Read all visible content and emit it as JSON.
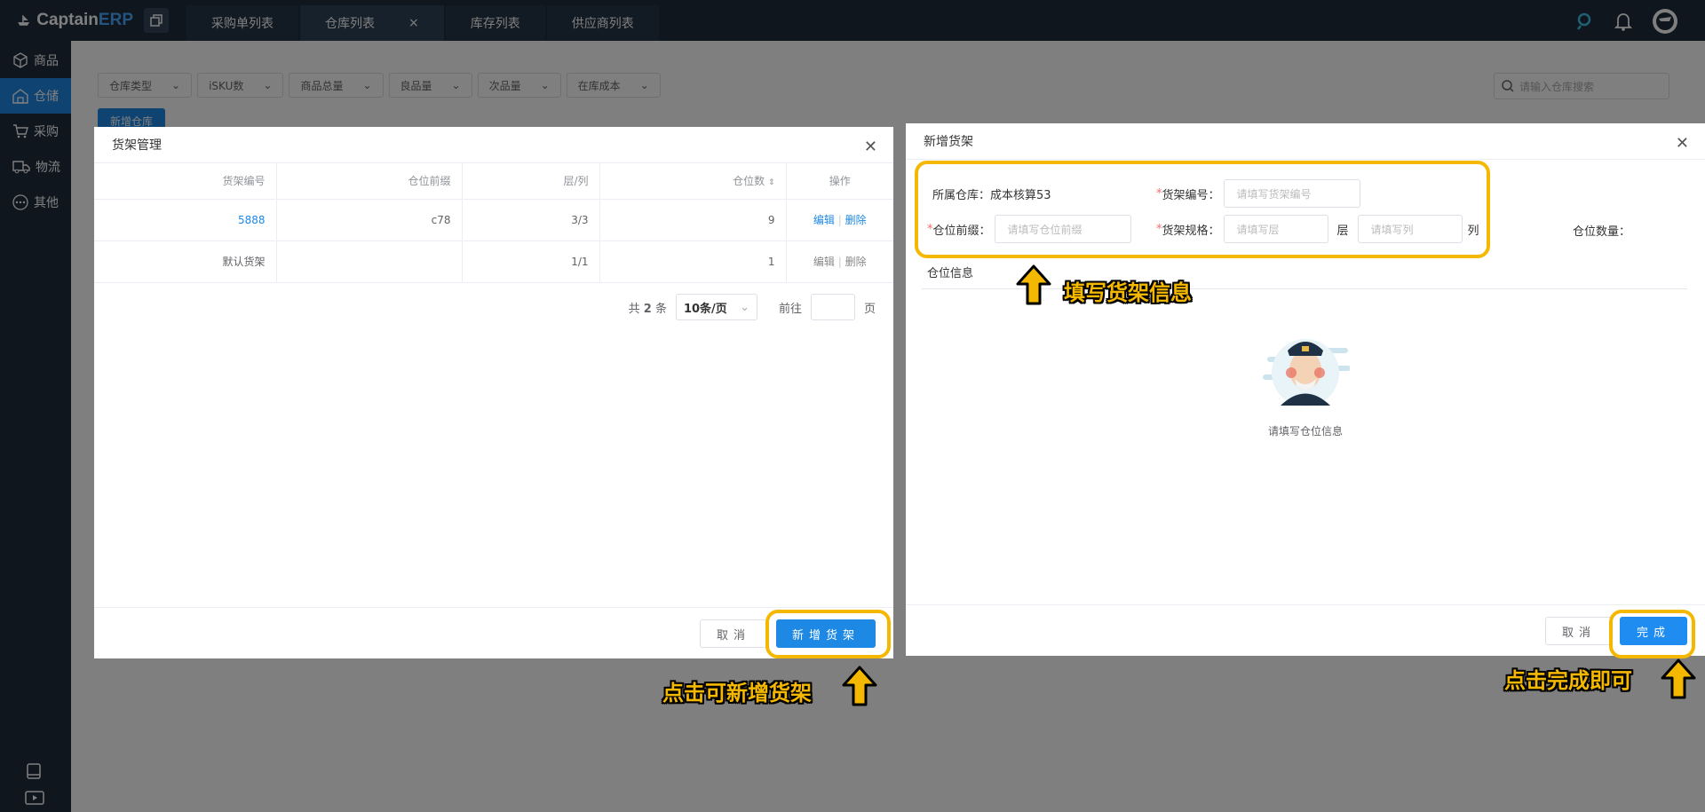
{
  "app": {
    "brand_main": "Captain",
    "brand_accent": "ERP"
  },
  "tabs": [
    {
      "label": "采购单列表"
    },
    {
      "label": "仓库列表",
      "close": "×"
    },
    {
      "label": "库存列表"
    },
    {
      "label": "供应商列表"
    }
  ],
  "sidebar": {
    "items": [
      {
        "label": "商品"
      },
      {
        "label": "仓储"
      },
      {
        "label": "采购"
      },
      {
        "label": "物流"
      },
      {
        "label": "其他"
      }
    ]
  },
  "filters": [
    "仓库类型",
    "iSKU数",
    "商品总量",
    "良品量",
    "次品量",
    "在库成本"
  ],
  "search_placeholder": "请输入仓库搜索",
  "new_warehouse": "新增仓库",
  "shelf_dialog": {
    "title": "货架管理",
    "columns": [
      "货架编号",
      "仓位前缀",
      "层/列",
      "仓位数",
      "操作"
    ],
    "rows": [
      {
        "code": "5888",
        "prefix": "c78",
        "layers": "3/3",
        "slots": "9",
        "edit": "编辑",
        "sep": "|",
        "delete": "删除"
      },
      {
        "code": "默认货架",
        "prefix": "",
        "layers": "1/1",
        "slots": "1",
        "edit": "编辑",
        "sep": "|",
        "delete": "删除"
      }
    ],
    "pager": {
      "total_prefix": "共",
      "total": "2",
      "total_suffix": "条",
      "page_size": "10条/页",
      "goto": "前往",
      "page_unit": "页"
    },
    "cancel": "取消",
    "add": "新增货架"
  },
  "add_dialog": {
    "title": "新增货架",
    "warehouse_label": "所属仓库：",
    "warehouse_value": "成本核算53",
    "shelf_code_label": "货架编号：",
    "shelf_code_placeholder": "请填写货架编号",
    "prefix_label": "仓位前缀：",
    "prefix_placeholder": "请填写仓位前缀",
    "spec_label": "货架规格：",
    "layer_placeholder": "请填写层",
    "layer_unit": "层",
    "column_placeholder": "请填写列",
    "column_unit": "列",
    "slot_count_label": "仓位数量：",
    "section_title": "仓位信息",
    "empty_text": "请填写仓位信息",
    "required_mark": "*",
    "cancel": "取消",
    "done": "完成"
  },
  "annotations": {
    "fill_info": "填写货架信息",
    "click_add": "点击可新增货架",
    "click_done": "点击完成即可"
  },
  "colors": {
    "accent": "#1e88e5",
    "highlight": "#f5b800",
    "sidebar": "#1f2d3d"
  }
}
